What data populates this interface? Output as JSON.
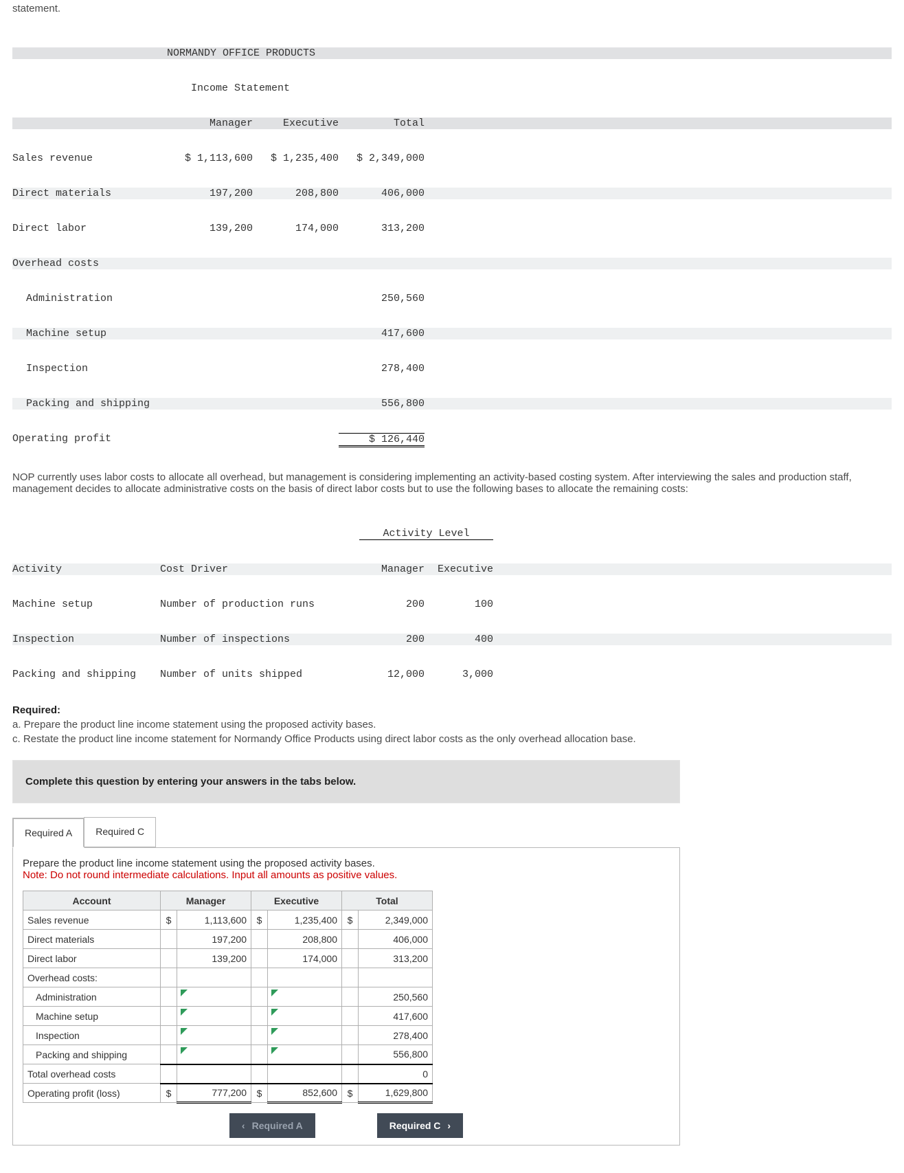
{
  "top_word": "statement.",
  "income": {
    "title": "NORMANDY OFFICE PRODUCTS",
    "subtitle": "Income Statement",
    "cols": {
      "c1": "Manager",
      "c2": "Executive",
      "c3": "Total"
    },
    "rows": {
      "sales": {
        "label": "Sales revenue",
        "c1": "$ 1,113,600",
        "c2": "$ 1,235,400",
        "c3": "$ 2,349,000"
      },
      "dm": {
        "label": "Direct materials",
        "c1": "197,200",
        "c2": "208,800",
        "c3": "406,000"
      },
      "dl": {
        "label": "Direct labor",
        "c1": "139,200",
        "c2": "174,000",
        "c3": "313,200"
      },
      "oh": {
        "label": "Overhead costs"
      },
      "admin": {
        "label": "Administration",
        "c3": "250,560"
      },
      "msetup": {
        "label": "Machine setup",
        "c3": "417,600"
      },
      "insp": {
        "label": "Inspection",
        "c3": "278,400"
      },
      "pack": {
        "label": "Packing and shipping",
        "c3": "556,800"
      },
      "op": {
        "label": "Operating profit",
        "c3": "$ 126,440"
      }
    }
  },
  "para1": "NOP currently uses labor costs to allocate all overhead, but management is considering implementing an activity-based costing system. After interviewing the sales and production staff, management decides to allocate administrative costs on the basis of direct labor costs but to use the following bases to allocate the remaining costs:",
  "activity": {
    "h_level": "Activity Level",
    "h_activity": "Activity",
    "h_driver": "Cost Driver",
    "h_mgr": "Manager",
    "h_exec": "Executive",
    "rows": {
      "r1": {
        "a": "Machine setup",
        "d": "Number of production runs",
        "m": "200",
        "e": "100"
      },
      "r2": {
        "a": "Inspection",
        "d": "Number of inspections",
        "m": "200",
        "e": "400"
      },
      "r3": {
        "a": "Packing and shipping",
        "d": "Number of units shipped",
        "m": "12,000",
        "e": "3,000"
      }
    }
  },
  "required": {
    "title": "Required:",
    "a": "a. Prepare the product line income statement using the proposed activity bases.",
    "c": "c. Restate the product line income statement for Normandy Office Products using direct labor costs as the only overhead allocation base."
  },
  "instruction_band": "Complete this question by entering your answers in the tabs below.",
  "tabs": {
    "a": "Required A",
    "c": "Required C"
  },
  "tab_body": {
    "line1": "Prepare the product line income statement using the proposed activity bases.",
    "note": "Note: Do not round intermediate calculations. Input all amounts as positive values."
  },
  "table": {
    "headers": {
      "acct": "Account",
      "mgr": "Manager",
      "exec": "Executive",
      "tot": "Total"
    },
    "rows": {
      "sales": {
        "label": "Sales revenue",
        "ds": "$",
        "m": "1,113,600",
        "e": "1,235,400",
        "t": "2,349,000"
      },
      "dm": {
        "label": "Direct materials",
        "ds": "",
        "m": "197,200",
        "e": "208,800",
        "t": "406,000"
      },
      "dl": {
        "label": "Direct labor",
        "ds": "",
        "m": "139,200",
        "e": "174,000",
        "t": "313,200"
      },
      "ohh": {
        "label": "Overhead costs:"
      },
      "admin": {
        "label": "Administration",
        "t": "250,560"
      },
      "msetup": {
        "label": "Machine setup",
        "t": "417,600"
      },
      "insp": {
        "label": "Inspection",
        "t": "278,400"
      },
      "pack": {
        "label": "Packing and shipping",
        "t": "556,800"
      },
      "totoh": {
        "label": "Total overhead costs",
        "t": "0"
      },
      "op": {
        "label": "Operating profit (loss)",
        "ds": "$",
        "m": "777,200",
        "e": "852,600",
        "t": "1,629,800"
      }
    }
  },
  "nav": {
    "prev": "Required A",
    "next": "Required C"
  },
  "chart_data": {
    "type": "table",
    "income_statement": {
      "company": "NORMANDY OFFICE PRODUCTS",
      "columns": [
        "Manager",
        "Executive",
        "Total"
      ],
      "rows": [
        {
          "account": "Sales revenue",
          "Manager": 1113600,
          "Executive": 1235400,
          "Total": 2349000
        },
        {
          "account": "Direct materials",
          "Manager": 197200,
          "Executive": 208800,
          "Total": 406000
        },
        {
          "account": "Direct labor",
          "Manager": 139200,
          "Executive": 174000,
          "Total": 313200
        },
        {
          "account": "Overhead - Administration",
          "Total": 250560
        },
        {
          "account": "Overhead - Machine setup",
          "Total": 417600
        },
        {
          "account": "Overhead - Inspection",
          "Total": 278400
        },
        {
          "account": "Overhead - Packing and shipping",
          "Total": 556800
        },
        {
          "account": "Operating profit",
          "Total": 126440
        }
      ]
    },
    "activity_levels": {
      "columns": [
        "Activity",
        "Cost Driver",
        "Manager",
        "Executive"
      ],
      "rows": [
        {
          "Activity": "Machine setup",
          "Cost Driver": "Number of production runs",
          "Manager": 200,
          "Executive": 100
        },
        {
          "Activity": "Inspection",
          "Cost Driver": "Number of inspections",
          "Manager": 200,
          "Executive": 400
        },
        {
          "Activity": "Packing and shipping",
          "Cost Driver": "Number of units shipped",
          "Manager": 12000,
          "Executive": 3000
        }
      ]
    },
    "answer_table": {
      "columns": [
        "Account",
        "Manager",
        "Executive",
        "Total"
      ],
      "rows": [
        {
          "Account": "Sales revenue",
          "Manager": 1113600,
          "Executive": 1235400,
          "Total": 2349000
        },
        {
          "Account": "Direct materials",
          "Manager": 197200,
          "Executive": 208800,
          "Total": 406000
        },
        {
          "Account": "Direct labor",
          "Manager": 139200,
          "Executive": 174000,
          "Total": 313200
        },
        {
          "Account": "Overhead costs:"
        },
        {
          "Account": "Administration",
          "Total": 250560
        },
        {
          "Account": "Machine setup",
          "Total": 417600
        },
        {
          "Account": "Inspection",
          "Total": 278400
        },
        {
          "Account": "Packing and shipping",
          "Total": 556800
        },
        {
          "Account": "Total overhead costs",
          "Total": 0
        },
        {
          "Account": "Operating profit (loss)",
          "Manager": 777200,
          "Executive": 852600,
          "Total": 1629800
        }
      ]
    }
  }
}
